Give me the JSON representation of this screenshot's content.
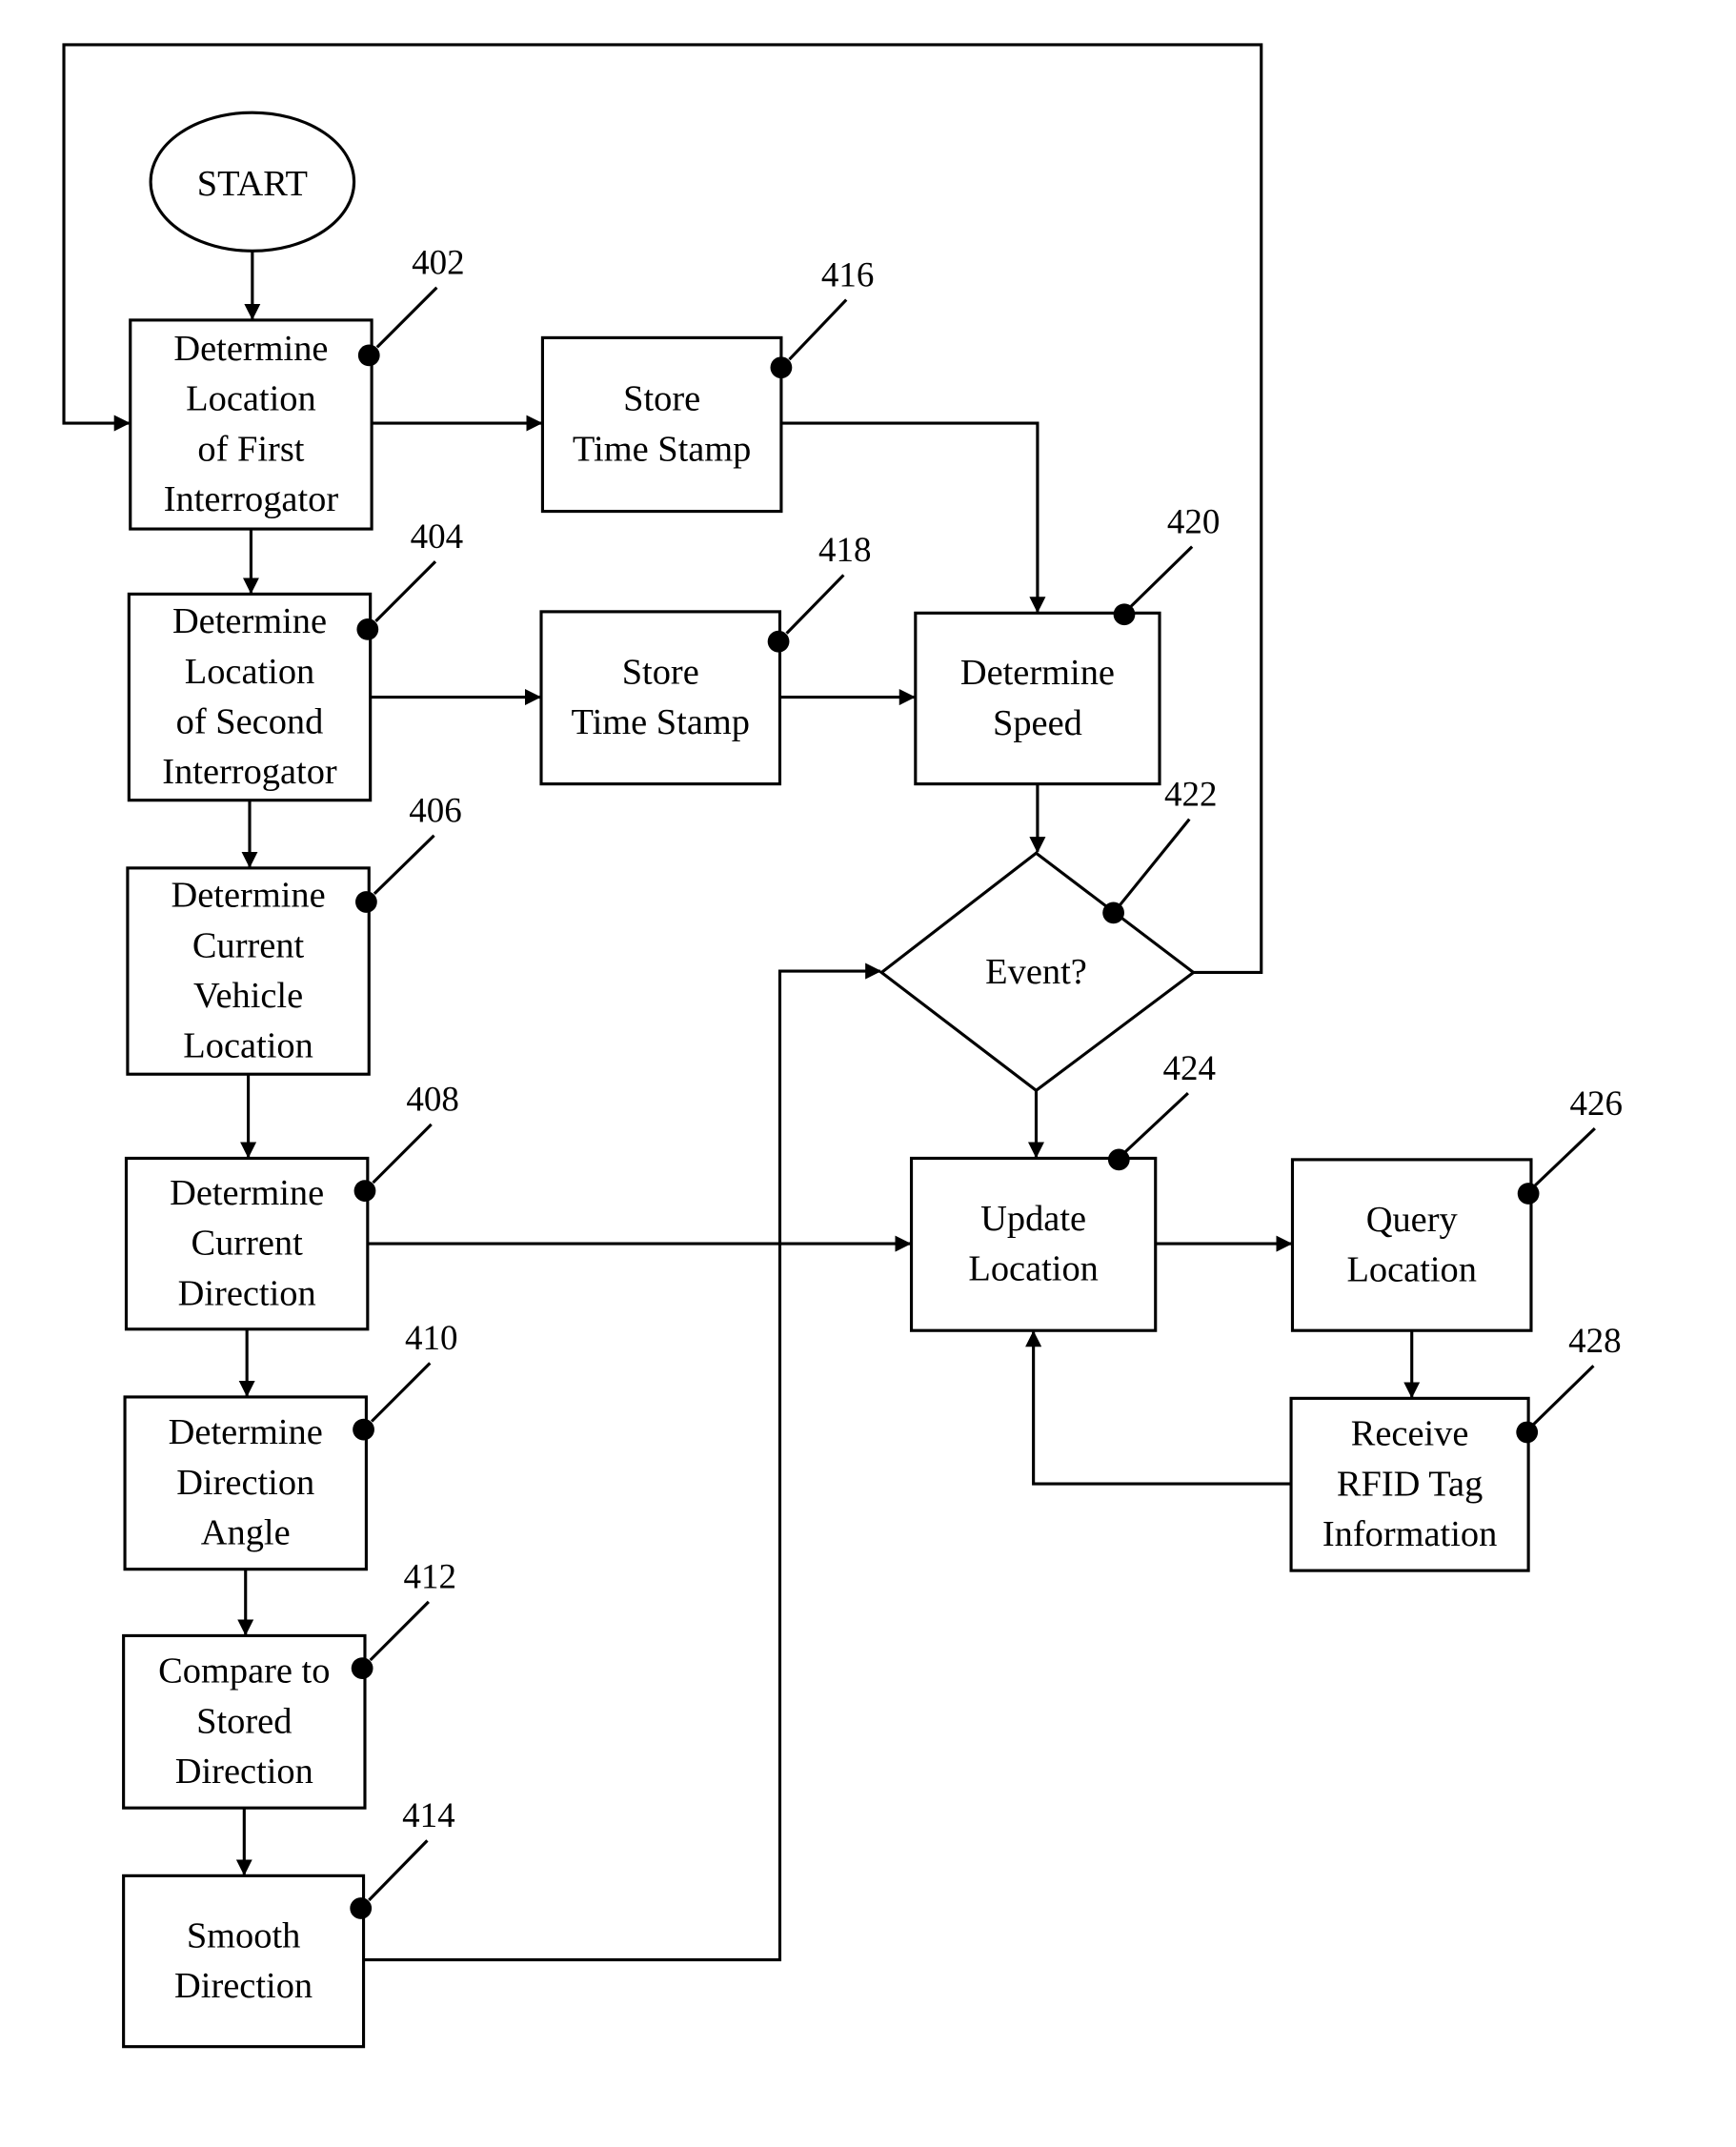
{
  "figure": {
    "start": {
      "label": "START"
    },
    "nodes": [
      {
        "id": "402",
        "ref": "402",
        "lines": [
          "Determine",
          "Location",
          "of First",
          "Interrogator"
        ]
      },
      {
        "id": "404",
        "ref": "404",
        "lines": [
          "Determine",
          "Location",
          "of Second",
          "Interrogator"
        ]
      },
      {
        "id": "406",
        "ref": "406",
        "lines": [
          "Determine",
          "Current",
          "Vehicle",
          "Location"
        ]
      },
      {
        "id": "408",
        "ref": "408",
        "lines": [
          "Determine",
          "Current",
          "Direction"
        ]
      },
      {
        "id": "410",
        "ref": "410",
        "lines": [
          "Determine",
          "Direction",
          "Angle"
        ]
      },
      {
        "id": "412",
        "ref": "412",
        "lines": [
          "Compare to",
          "Stored",
          "Direction"
        ]
      },
      {
        "id": "414",
        "ref": "414",
        "lines": [
          "Smooth",
          "Direction"
        ]
      },
      {
        "id": "416",
        "ref": "416",
        "lines": [
          "Store",
          "Time Stamp"
        ]
      },
      {
        "id": "418",
        "ref": "418",
        "lines": [
          "Store",
          "Time Stamp"
        ]
      },
      {
        "id": "420",
        "ref": "420",
        "lines": [
          "Determine",
          "Speed"
        ]
      },
      {
        "id": "422",
        "ref": "422",
        "lines": [
          "Event?"
        ]
      },
      {
        "id": "424",
        "ref": "424",
        "lines": [
          "Update",
          "Location"
        ]
      },
      {
        "id": "426",
        "ref": "426",
        "lines": [
          "Query",
          "Location"
        ]
      },
      {
        "id": "428",
        "ref": "428",
        "lines": [
          "Receive",
          "RFID Tag",
          "Information"
        ]
      }
    ]
  }
}
